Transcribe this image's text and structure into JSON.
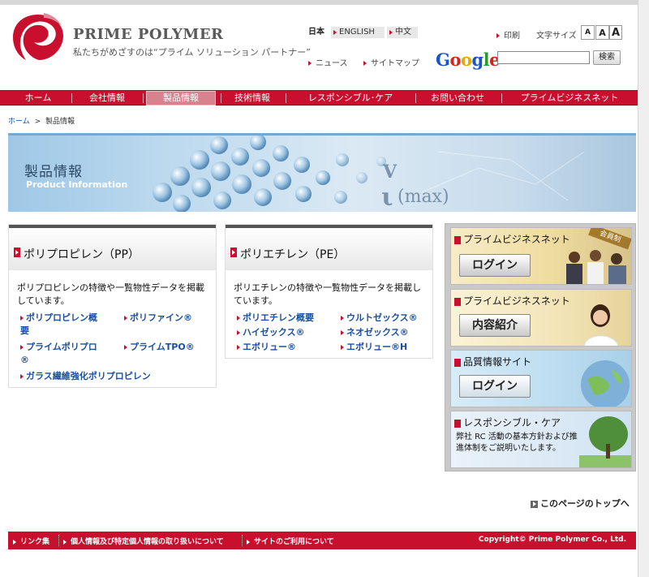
{
  "header": {
    "brand": "PRIME POLYMER",
    "tagline": "私たちがめざすのは“プライム ソリューション パートナー”",
    "languages": {
      "current": "日本",
      "english": "ENGLISH",
      "chinese": "中文"
    },
    "print": "印刷",
    "font_size_label": "文字サイズ",
    "font_sizes": [
      "A",
      "A",
      "A"
    ],
    "news": "ニュース",
    "sitemap": "サイトマップ",
    "google": [
      "G",
      "o",
      "o",
      "g",
      "l",
      "e"
    ],
    "google_tm": "TM",
    "search": {
      "value": "",
      "placeholder": "",
      "button": "検索"
    }
  },
  "nav": [
    "ホーム",
    "会社情報",
    "製品情報",
    "技術情報",
    "レスポンシブル･ケア",
    "お問い合わせ",
    "プライムビジネスネット"
  ],
  "breadcrumb": {
    "home": "ホーム",
    "sep": ">",
    "current": "製品情報"
  },
  "banner": {
    "title": "製品情報",
    "subtitle": "Product Information",
    "formula_1": "V",
    "formula_2": "ι",
    "formula_3": "(max)"
  },
  "columns": [
    {
      "title": "ポリプロピレン（PP）",
      "description": "ポリプロピレンの特徴や一覧物性データを掲載しています。",
      "links": [
        "ポリプロピレン概要",
        "ポリファイン®",
        "プライムポリプロ®",
        "プライムTPO®",
        "ガラス繊維強化ポリプロピレン"
      ]
    },
    {
      "title": "ポリエチレン（PE）",
      "description": "ポリエチレンの特徴や一覧物性データを掲載しています。",
      "links": [
        "ポリエチレン概要",
        "ウルトゼックス®",
        "ハイゼックス®",
        "ネオゼックス®",
        "エボリュー®",
        "エボリュー®H"
      ]
    }
  ],
  "side_banners": [
    {
      "title": "プライムビジネスネット",
      "button": "ログイン",
      "badge": "会員制"
    },
    {
      "title": "プライムビジネスネット",
      "button": "内容紹介"
    },
    {
      "title": "品質情報サイト",
      "button": "ログイン"
    },
    {
      "title": "レスポンシブル・ケア",
      "text": "弊社 RC 活動の基本方針および推進体制をご説明いたします。"
    }
  ],
  "page_top": "このページのトップへ",
  "footer": {
    "links": [
      "リンク集",
      "個人情報及び特定個人情報の取り扱いについて",
      "サイトのご利用について"
    ],
    "copyright": "Copyright© Prime Polymer Co., Ltd."
  },
  "colors": {
    "brand_red": "#c8102e",
    "link_blue": "#1a4fa0"
  }
}
